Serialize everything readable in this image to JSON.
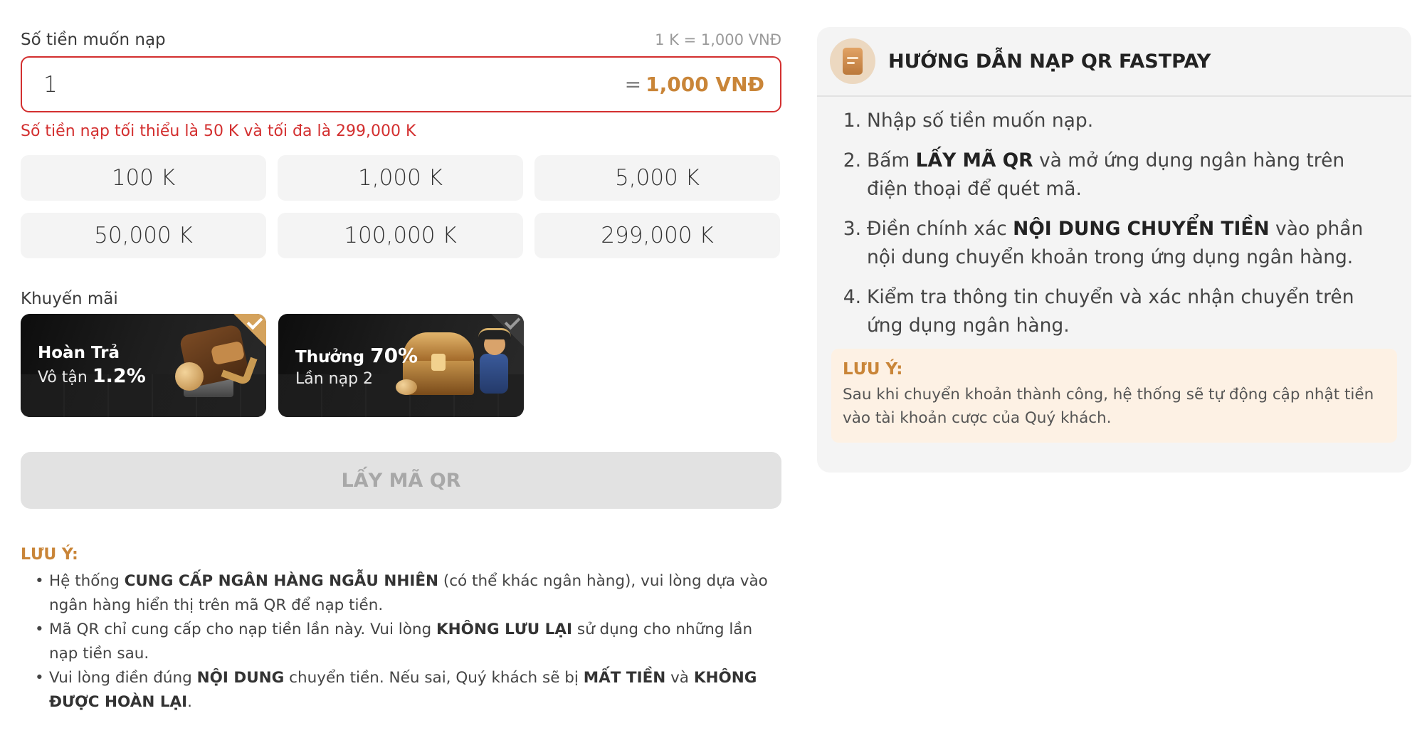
{
  "deposit": {
    "label": "Số tiền muốn nạp",
    "rate": "1 K = 1,000 VNĐ",
    "amount_value": "1",
    "converted_prefix": "=",
    "converted_value": "1,000 VNĐ",
    "error": "Số tiền nạp tối thiểu là 50 K và tối đa là 299,000 K"
  },
  "presets": [
    "100 K",
    "1,000 K",
    "5,000 K",
    "50,000 K",
    "100,000 K",
    "299,000 K"
  ],
  "promotions": {
    "label": "Khuyến mãi",
    "cards": [
      {
        "title": "Hoàn Trả",
        "sub_prefix": "Vô tận",
        "sub_highlight": "1.2%",
        "selected": true
      },
      {
        "title": "Thưởng",
        "title_highlight": "70%",
        "sub_prefix": "Lần nạp 2",
        "selected": false
      }
    ]
  },
  "qr_button": {
    "label": "LẤY MÃ QR",
    "enabled": false
  },
  "note": {
    "title": "LƯU Ý:",
    "items": [
      {
        "parts": [
          {
            "t": "Hệ thống "
          },
          {
            "b": "CUNG CẤP NGÂN HÀNG NGẪU NHIÊN"
          },
          {
            "t": " (có thể khác ngân hàng), vui lòng dựa vào ngân hàng hiển thị trên mã QR để nạp tiền."
          }
        ]
      },
      {
        "parts": [
          {
            "t": "Mã QR chỉ cung cấp cho nạp tiền lần này. Vui lòng "
          },
          {
            "b": "KHÔNG LƯU LẠI"
          },
          {
            "t": " sử dụng cho những lần nạp tiền sau."
          }
        ]
      },
      {
        "parts": [
          {
            "t": "Vui lòng điền đúng "
          },
          {
            "b": "NỘI DUNG"
          },
          {
            "t": " chuyển tiền. Nếu sai, Quý khách sẽ bị "
          },
          {
            "b": "MẤT TIỀN"
          },
          {
            "t": " và "
          },
          {
            "b": "KHÔNG ĐƯỢC HOÀN LẠI"
          },
          {
            "t": "."
          }
        ]
      }
    ]
  },
  "guide": {
    "title": "HƯỚNG DẪN NẠP QR FASTPAY",
    "steps": [
      {
        "num": "1.",
        "parts": [
          {
            "t": "Nhập số tiền muốn nạp."
          }
        ]
      },
      {
        "num": "2.",
        "parts": [
          {
            "t": "Bấm "
          },
          {
            "b": "LẤY MÃ QR"
          },
          {
            "t": " và mở ứng dụng ngân hàng trên điện thoại để quét mã."
          }
        ]
      },
      {
        "num": "3.",
        "parts": [
          {
            "t": "Điền chính xác "
          },
          {
            "b": "NỘI DUNG CHUYỂN TIỀN"
          },
          {
            "t": " vào phần nội dung chuyển khoản trong ứng dụng ngân hàng."
          }
        ]
      },
      {
        "num": "4.",
        "parts": [
          {
            "t": "Kiểm tra thông tin chuyển và xác nhận chuyển trên ứng dụng ngân hàng."
          }
        ]
      }
    ],
    "note_title": "LƯU Ý:",
    "note_text": "Sau khi chuyển khoản thành công, hệ thống sẽ tự động cập nhật tiền vào tài khoản cược của Quý khách."
  },
  "colors": {
    "accent": "#c98538",
    "error": "#d32f2f",
    "panel_bg": "#f4f4f4",
    "note_bg": "#fdf1e4"
  },
  "icons": {
    "guide": "document-icon",
    "selected": "checkmark-icon"
  }
}
